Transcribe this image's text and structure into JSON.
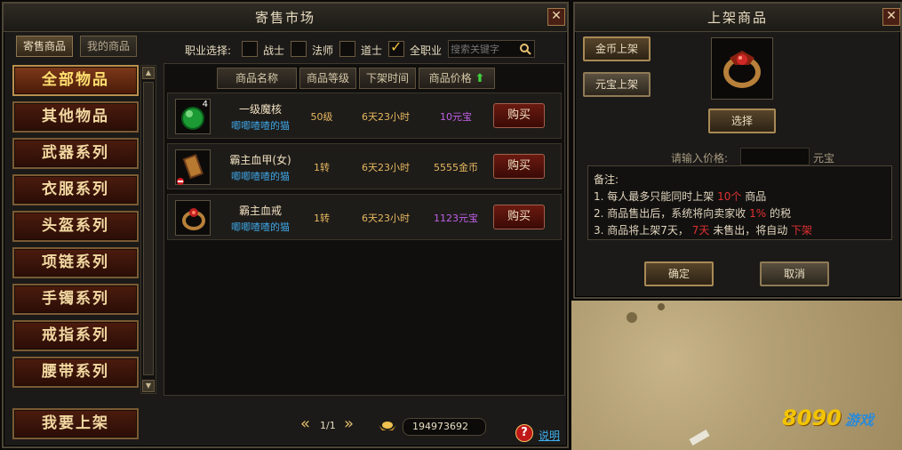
{
  "market": {
    "title": "寄售市场",
    "close": "✕",
    "tabs": [
      "寄售商品",
      "我的商品"
    ],
    "filter_label": "职业选择:",
    "filters": [
      {
        "label": "战士",
        "checked": false
      },
      {
        "label": "法师",
        "checked": false
      },
      {
        "label": "道士",
        "checked": false
      },
      {
        "label": "全职业",
        "checked": true
      }
    ],
    "search_placeholder": "搜索关键字",
    "categories": [
      "全部物品",
      "其他物品",
      "武器系列",
      "衣服系列",
      "头盔系列",
      "项链系列",
      "手镯系列",
      "戒指系列",
      "腰带系列"
    ],
    "columns": [
      "商品名称",
      "商品等级",
      "下架时间",
      "商品价格"
    ],
    "items": [
      {
        "name": "一级魔核",
        "seller": "唧唧喳喳的猫",
        "level": "50级",
        "time": "6天23小时",
        "price": "10元宝",
        "price_color": "#c060e8",
        "count": "4",
        "icon": "green-orb-icon"
      },
      {
        "name": "霸主血甲(女)",
        "seller": "唧唧喳喳的猫",
        "level": "1转",
        "time": "6天23小时",
        "price": "5555金币",
        "price_color": "#e6b860",
        "icon": "armor-icon"
      },
      {
        "name": "霸主血戒",
        "seller": "唧唧喳喳的猫",
        "level": "1转",
        "time": "6天23小时",
        "price": "1123元宝",
        "price_color": "#c060e8",
        "icon": "ring-icon"
      }
    ],
    "buy_label": "购买",
    "list_button": "我要上架",
    "page": "1/1",
    "gold_amount": "194973692",
    "help_label": "说明"
  },
  "listing": {
    "title": "上架商品",
    "close": "✕",
    "gold_btn": "金币上架",
    "yuanbao_btn": "元宝上架",
    "select_btn": "选择",
    "price_label": "请输入价格:",
    "price_value": "",
    "price_unit": "元宝",
    "notes_title": "备注:",
    "note1_a": "1. 每人最多只能同时上架",
    "note1_b": "10个",
    "note1_c": "商品",
    "note2_a": "2. 商品售出后，系统将向卖家收",
    "note2_b": "1%",
    "note2_c": "的税",
    "note3_a": "3. 商品将上架7天，",
    "note3_b": "7天",
    "note3_c": "未售出，将自动",
    "note3_d": "下架",
    "confirm": "确定",
    "cancel": "取消"
  },
  "watermark": {
    "digits": "8090",
    "text": "游戏"
  },
  "colors": {
    "accent_red": "#e03030",
    "accent_blue": "#3fa8e8",
    "accent_gold": "#e6b860",
    "accent_purple": "#c060e8"
  }
}
